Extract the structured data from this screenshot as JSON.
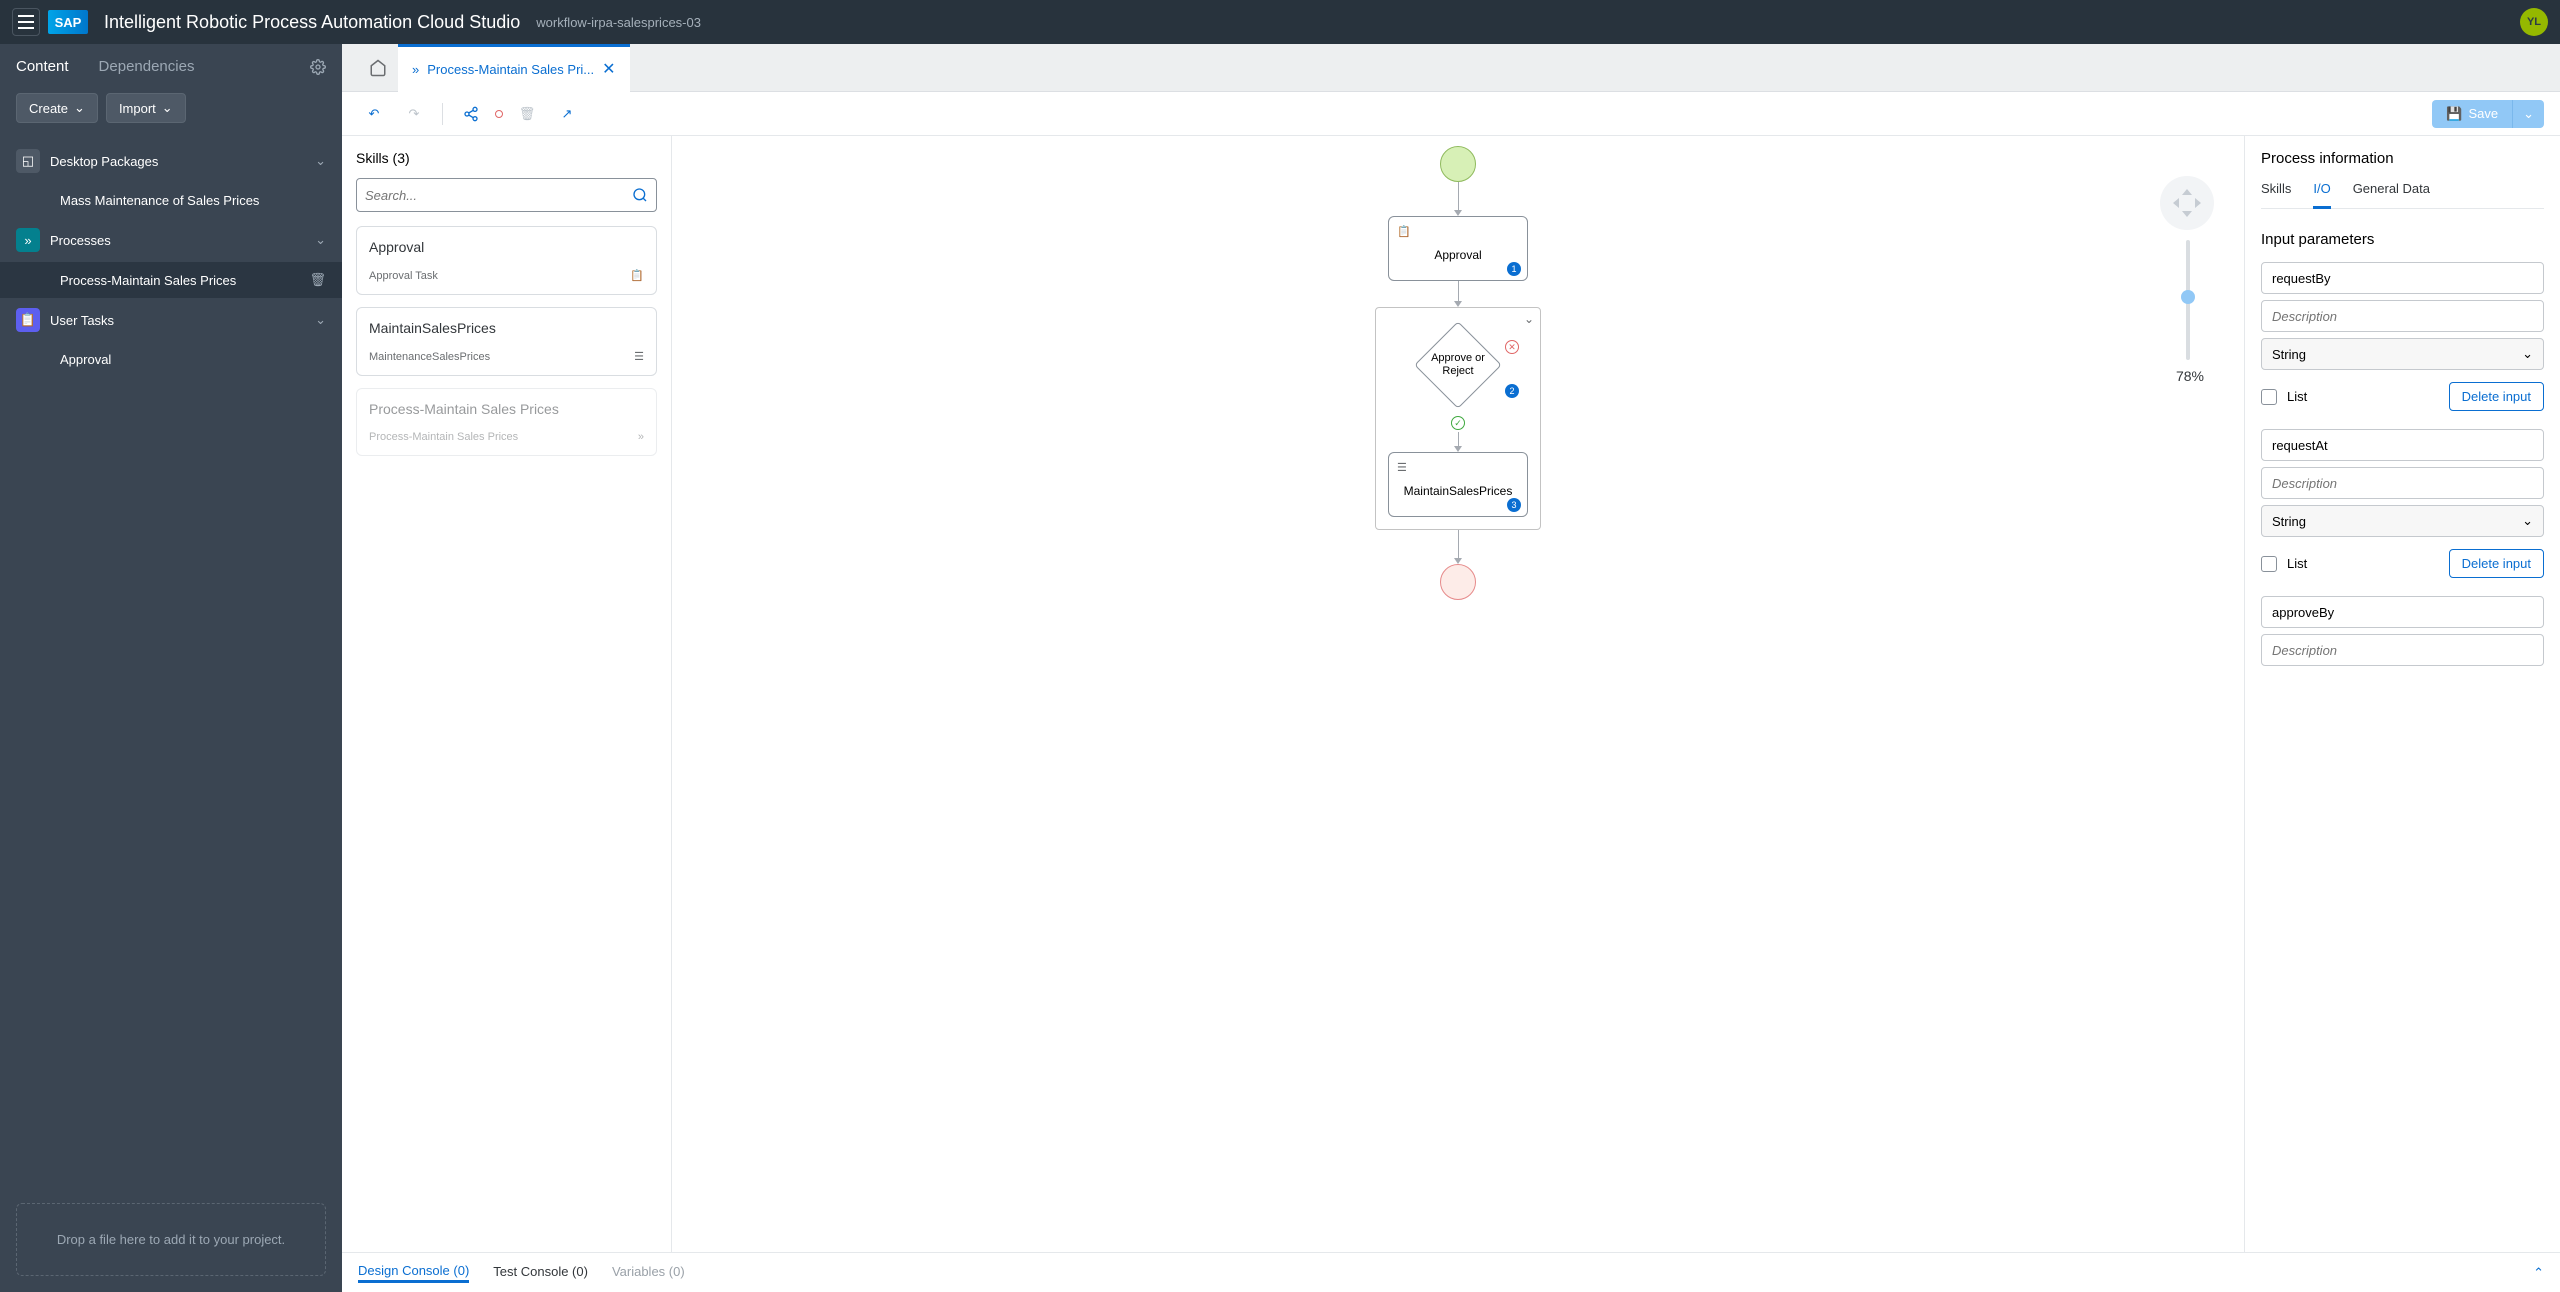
{
  "header": {
    "app_title": "Intelligent Robotic Process Automation Cloud Studio",
    "workflow": "workflow-irpa-salesprices-03",
    "avatar": "YL"
  },
  "sidebar": {
    "tabs": {
      "content": "Content",
      "dependencies": "Dependencies"
    },
    "buttons": {
      "create": "Create",
      "import": "Import"
    },
    "groups": {
      "desktop": "Desktop Packages",
      "desktop_child": "Mass Maintenance of Sales Prices",
      "processes": "Processes",
      "processes_child": "Process-Maintain Sales Prices",
      "user_tasks": "User Tasks",
      "user_tasks_child": "Approval"
    },
    "dropzone": "Drop a file here to add it to your project."
  },
  "editor": {
    "tab_label": "Process-Maintain Sales Pri...",
    "save": "Save"
  },
  "skills": {
    "title": "Skills (3)",
    "search_placeholder": "Search...",
    "cards": [
      {
        "name": "Approval",
        "sub": "Approval Task"
      },
      {
        "name": "MaintainSalesPrices",
        "sub": "MaintenanceSalesPrices"
      },
      {
        "name": "Process-Maintain Sales Prices",
        "sub": "Process-Maintain Sales Prices"
      }
    ]
  },
  "canvas": {
    "approval": "Approval",
    "decision": "Approve or Reject",
    "maintain": "MaintainSalesPrices",
    "zoom": "78%"
  },
  "props": {
    "title": "Process information",
    "tabs": {
      "skills": "Skills",
      "io": "I/O",
      "general": "General Data"
    },
    "section": "Input parameters",
    "params": [
      {
        "name": "requestBy",
        "desc_ph": "Description",
        "type": "String",
        "list": "List",
        "delete": "Delete input"
      },
      {
        "name": "requestAt",
        "desc_ph": "Description",
        "type": "String",
        "list": "List",
        "delete": "Delete input"
      },
      {
        "name": "approveBy",
        "desc_ph": "Description"
      }
    ]
  },
  "bottom": {
    "design": "Design Console (0)",
    "test": "Test Console (0)",
    "vars": "Variables (0)"
  }
}
